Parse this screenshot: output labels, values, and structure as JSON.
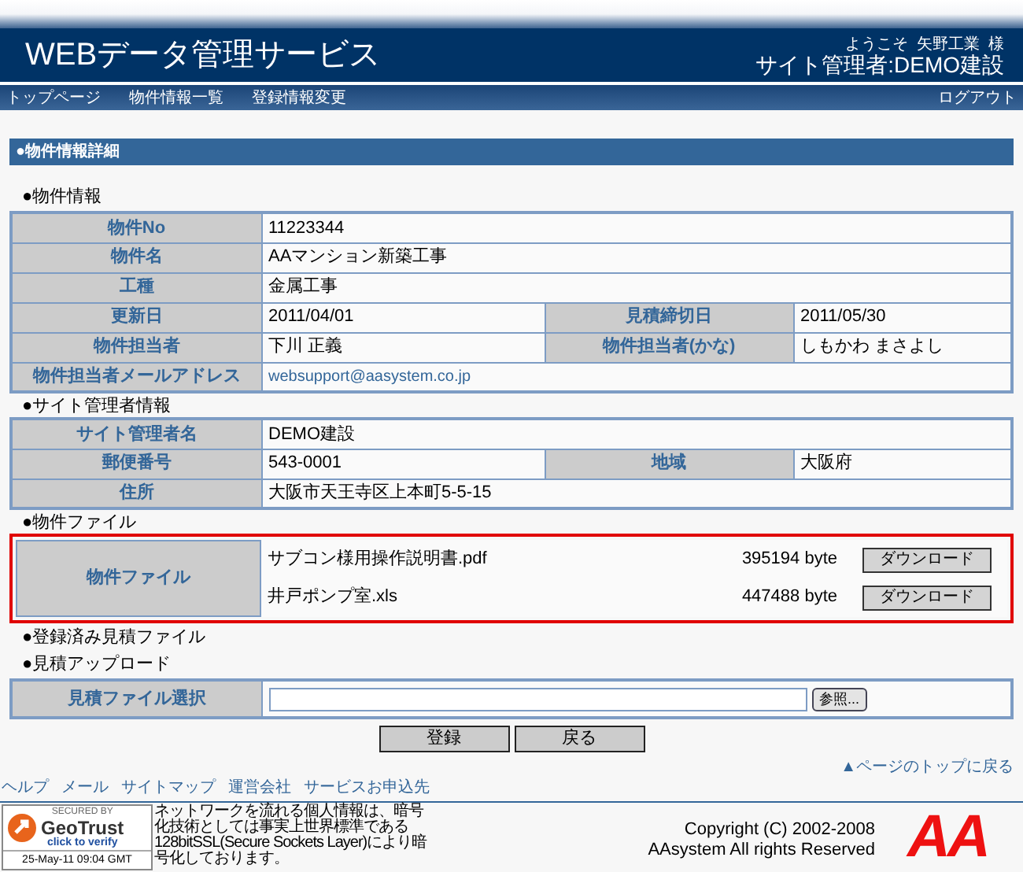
{
  "header": {
    "title": "WEBデータ管理サービス",
    "welcome": "ようこそ  矢野工業  様",
    "admin": "サイト管理者:DEMO建設"
  },
  "nav": {
    "items": [
      "トップページ",
      "物件情報一覧",
      "登録情報変更"
    ],
    "logout": "ログアウト"
  },
  "section_title": "●物件情報詳細",
  "property": {
    "heading": "●物件情報",
    "rows": [
      {
        "fields": [
          {
            "label": "物件No",
            "value": "11223344"
          }
        ]
      },
      {
        "fields": [
          {
            "label": "物件名",
            "value": "AAマンション新築工事"
          }
        ]
      },
      {
        "fields": [
          {
            "label": "工種",
            "value": "金属工事"
          }
        ]
      },
      {
        "fields": [
          {
            "label": "更新日",
            "value": "2011/04/01"
          },
          {
            "label": "見積締切日",
            "value": "2011/05/30"
          }
        ]
      },
      {
        "fields": [
          {
            "label": "物件担当者",
            "value": "下川  正義"
          },
          {
            "label": "物件担当者(かな)",
            "value": "しもかわ  まさよし"
          }
        ]
      },
      {
        "fields": [
          {
            "label": "物件担当者メールアドレス",
            "value": "websupport@aasystem.co.jp",
            "kind": "link"
          }
        ]
      }
    ]
  },
  "admin_info": {
    "heading": "●サイト管理者情報",
    "rows": [
      {
        "fields": [
          {
            "label": "サイト管理者名",
            "value": "DEMO建設"
          }
        ]
      },
      {
        "fields": [
          {
            "label": "郵便番号",
            "value": "543-0001"
          },
          {
            "label": "地域",
            "value": "大阪府"
          }
        ]
      },
      {
        "fields": [
          {
            "label": "住所",
            "value": "大阪市天王寺区上本町5-5-15"
          }
        ]
      }
    ]
  },
  "files": {
    "heading": "●物件ファイル",
    "label": "物件ファイル",
    "items": [
      {
        "name": "サブコン様用操作説明書.pdf",
        "size": "395194 byte",
        "button": "ダウンロード"
      },
      {
        "name": "井戸ポンプ室.xls",
        "size": "447488 byte",
        "button": "ダウンロード"
      }
    ]
  },
  "registered_heading": "●登録済み見積ファイル",
  "upload": {
    "heading": "●見積アップロード",
    "label": "見積ファイル選択",
    "browse": "参照..."
  },
  "buttons": [
    "登録",
    "戻る"
  ],
  "page_top": "▲ページのトップに戻る",
  "footer_links": [
    "ヘルプ",
    "メール",
    "サイトマップ",
    "運営会社",
    "サービスお申込先"
  ],
  "seal": {
    "secured": "SECURED BY",
    "brand": "GeoTrust",
    "verify": "click to verify",
    "date": "25-May-11 09:04 GMT"
  },
  "ssl_note": "ネットワークを流れる個人情報は、暗号化技術としては事実上世界標準である128bitSSL(Secure Sockets Layer)により暗号化しております。",
  "copyright": [
    "Copyright (C) 2002-2008",
    "AAsystem All rights Reserved"
  ],
  "logo_text": "AA"
}
